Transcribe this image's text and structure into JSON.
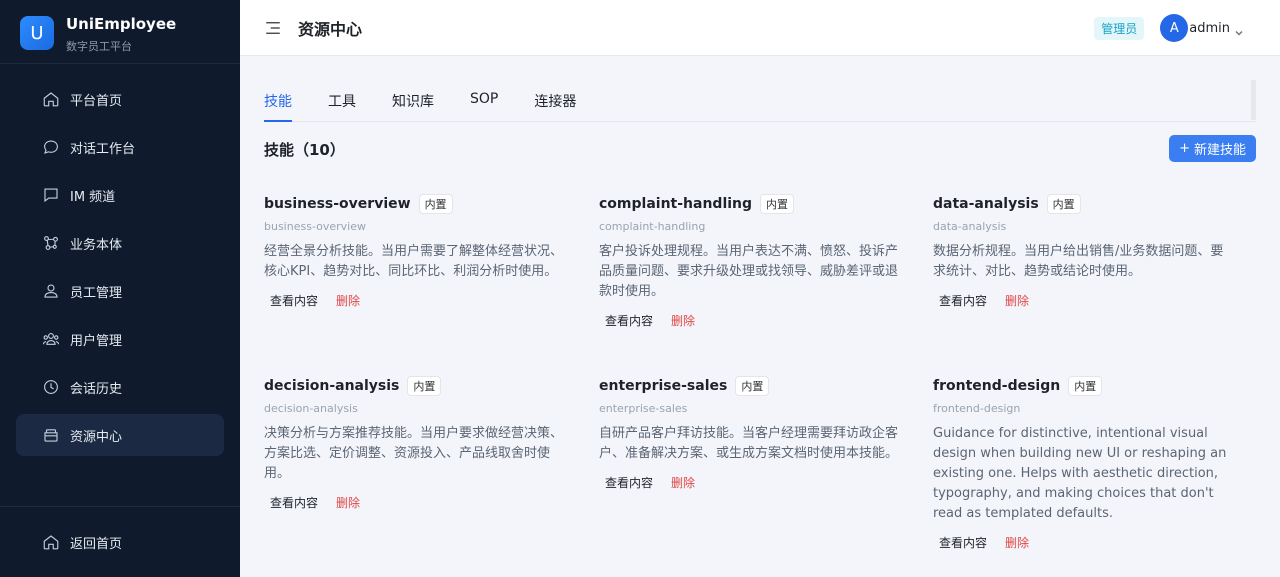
{
  "brand": {
    "logo_letter": "U",
    "name": "UniEmployee",
    "subtitle": "数字员工平台"
  },
  "sidebar": {
    "items": [
      {
        "label": "平台首页",
        "icon": "home-icon"
      },
      {
        "label": "对话工作台",
        "icon": "chat-bubble-icon"
      },
      {
        "label": "IM 频道",
        "icon": "message-square-icon"
      },
      {
        "label": "业务本体",
        "icon": "network-icon"
      },
      {
        "label": "员工管理",
        "icon": "user-icon"
      },
      {
        "label": "用户管理",
        "icon": "users-icon"
      },
      {
        "label": "会话历史",
        "icon": "clock-icon"
      },
      {
        "label": "资源中心",
        "icon": "box-icon",
        "active": true
      }
    ],
    "back_home": {
      "label": "返回首页",
      "icon": "home-icon"
    }
  },
  "header": {
    "title": "资源中心",
    "role_badge": "管理员",
    "avatar_letter": "A",
    "user_name": "admin"
  },
  "tabs": [
    {
      "label": "技能",
      "active": true
    },
    {
      "label": "工具"
    },
    {
      "label": "知识库"
    },
    {
      "label": "SOP"
    },
    {
      "label": "连接器"
    }
  ],
  "section": {
    "title": "技能（10）",
    "new_button": "新建技能",
    "new_button_plus": "+"
  },
  "cards": [
    {
      "title": "business-overview",
      "tag": "内置",
      "id": "business-overview",
      "desc": "经营全景分析技能。当用户需要了解整体经营状况、核心KPI、趋势对比、同比环比、利润分析时使用。",
      "view": "查看内容",
      "delete": "删除"
    },
    {
      "title": "complaint-handling",
      "tag": "内置",
      "id": "complaint-handling",
      "desc": "客户投诉处理规程。当用户表达不满、愤怒、投诉产品质量问题、要求升级处理或找领导、威胁差评或退款时使用。",
      "view": "查看内容",
      "delete": "删除"
    },
    {
      "title": "data-analysis",
      "tag": "内置",
      "id": "data-analysis",
      "desc": "数据分析规程。当用户给出销售/业务数据问题、要求统计、对比、趋势或结论时使用。",
      "view": "查看内容",
      "delete": "删除"
    },
    {
      "title": "decision-analysis",
      "tag": "内置",
      "id": "decision-analysis",
      "desc": "决策分析与方案推荐技能。当用户要求做经营决策、方案比选、定价调整、资源投入、产品线取舍时使用。",
      "view": "查看内容",
      "delete": "删除"
    },
    {
      "title": "enterprise-sales",
      "tag": "内置",
      "id": "enterprise-sales",
      "desc": "自研产品客户拜访技能。当客户经理需要拜访政企客户、准备解决方案、或生成方案文档时使用本技能。",
      "view": "查看内容",
      "delete": "删除"
    },
    {
      "title": "frontend-design",
      "tag": "内置",
      "id": "frontend-design",
      "desc": "Guidance for distinctive, intentional visual design when building new UI or reshaping an existing one. Helps with aesthetic direction, typography, and making choices that don't read as templated defaults.",
      "view": "查看内容",
      "delete": "删除"
    }
  ]
}
